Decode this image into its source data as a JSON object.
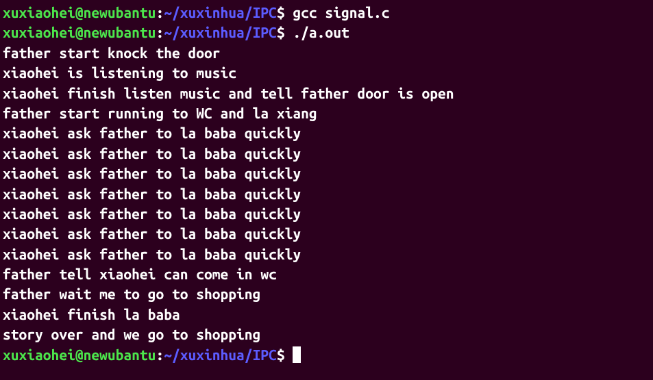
{
  "prompt": {
    "user_host": "xuxiaohei@newubantu",
    "colon": ":",
    "path": "~/xuxinhua/IPC",
    "dollar": "$"
  },
  "commands": [
    "gcc signal.c",
    "./a.out"
  ],
  "output_lines": [
    "father start knock the door",
    "xiaohei is listening to music",
    "xiaohei finish listen music and tell father door is open",
    "father start running to WC and la xiang",
    "xiaohei ask father to la baba quickly",
    "xiaohei ask father to la baba quickly",
    "xiaohei ask father to la baba quickly",
    "xiaohei ask father to la baba quickly",
    "xiaohei ask father to la baba quickly",
    "xiaohei ask father to la baba quickly",
    "xiaohei ask father to la baba quickly",
    "father tell xiaohei can come in wc",
    "father wait me to go to shopping",
    "xiaohei finish la baba",
    "story over and we go to shopping"
  ]
}
